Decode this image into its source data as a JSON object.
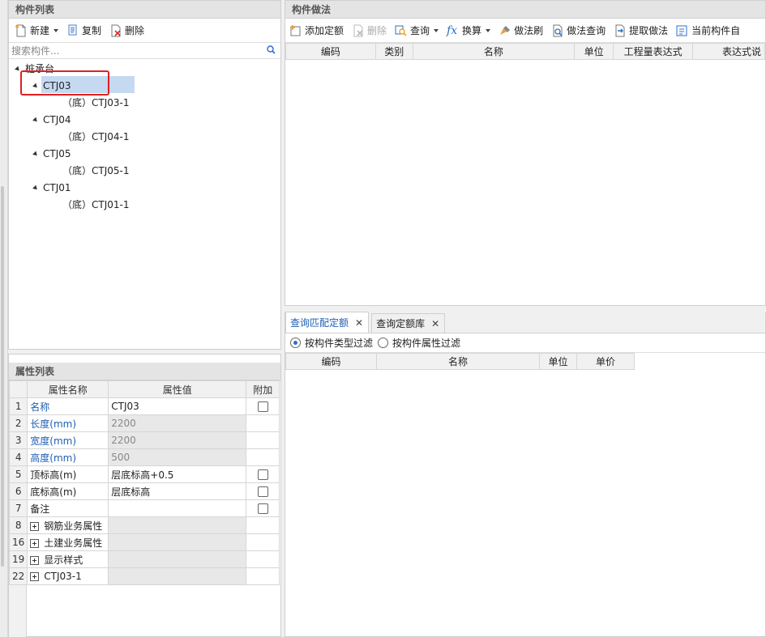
{
  "component_list": {
    "title": "构件列表",
    "toolbar": {
      "new": "新建",
      "copy": "复制",
      "delete": "删除"
    },
    "search_placeholder": "搜索构件...",
    "tree": {
      "root": "桩承台",
      "items": [
        {
          "label": "CTJ03",
          "child": "（底）CTJ03-1"
        },
        {
          "label": "CTJ04",
          "child": "（底）CTJ04-1"
        },
        {
          "label": "CTJ05",
          "child": "（底）CTJ05-1"
        },
        {
          "label": "CTJ01",
          "child": "（底）CTJ01-1"
        }
      ]
    }
  },
  "property_list": {
    "title": "属性列表",
    "headers": {
      "name": "属性名称",
      "value": "属性值",
      "extra": "附加"
    },
    "rows": [
      {
        "num": "1",
        "name": "名称",
        "value": "CTJ03"
      },
      {
        "num": "2",
        "name": "长度(mm)",
        "value": "2200"
      },
      {
        "num": "3",
        "name": "宽度(mm)",
        "value": "2200"
      },
      {
        "num": "4",
        "name": "高度(mm)",
        "value": "500"
      },
      {
        "num": "5",
        "name": "顶标高(m)",
        "value": "层底标高+0.5"
      },
      {
        "num": "6",
        "name": "底标高(m)",
        "value": "层底标高"
      },
      {
        "num": "7",
        "name": "备注",
        "value": ""
      },
      {
        "num": "8",
        "name": "钢筋业务属性",
        "value": ""
      },
      {
        "num": "16",
        "name": "土建业务属性",
        "value": ""
      },
      {
        "num": "19",
        "name": "显示样式",
        "value": ""
      },
      {
        "num": "22",
        "name": "CTJ03-1",
        "value": ""
      }
    ]
  },
  "method": {
    "title": "构件做法",
    "toolbar": {
      "add_quota": "添加定额",
      "delete": "删除",
      "query": "查询",
      "convert": "换算",
      "brush": "做法刷",
      "method_query": "做法查询",
      "extract": "提取做法",
      "current": "当前构件自"
    },
    "headers": [
      "编码",
      "类别",
      "名称",
      "单位",
      "工程量表达式",
      "表达式说"
    ]
  },
  "query": {
    "tabs": [
      {
        "label": "查询匹配定额"
      },
      {
        "label": "查询定额库"
      }
    ],
    "radio_type": "按构件类型过滤",
    "radio_attr": "按构件属性过滤",
    "headers": [
      "编码",
      "名称",
      "单位",
      "单价"
    ]
  }
}
